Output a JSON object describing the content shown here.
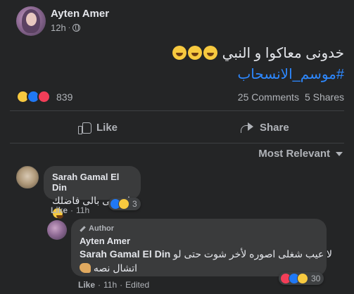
{
  "post": {
    "author": "Ayten Amer",
    "time": "12h",
    "separator": "·",
    "text": "خدونى معاكوا و النبي",
    "hashtag": "#موسم_الانسحاب"
  },
  "reactions": {
    "count": "839",
    "types": [
      "haha-icon",
      "like-icon",
      "love-icon"
    ],
    "comments": "25 Comments",
    "shares": "5 Shares"
  },
  "actions": {
    "like_label": "Like",
    "share_label": "Share"
  },
  "sort": {
    "label": "Most Relevant"
  },
  "comments": [
    {
      "name": "Sarah Gamal El Din",
      "text": "اتبرعى بالى فاضلك",
      "like_label": "Like",
      "time": "11h",
      "reaction_count": "3"
    },
    {
      "author_tag": "Author",
      "name": "Ayten Amer",
      "mention": "Sarah Gamal El Din",
      "text_line1": "لا عيب شغلى اصوره لأخر شوت حتى لو",
      "text_line2": "اتشال نصه",
      "like_label": "Like",
      "time": "11h",
      "edited": "Edited",
      "reaction_count": "30"
    }
  ],
  "colors": {
    "background": "#242526",
    "bubble": "#3a3b3c",
    "text_primary": "#e4e6eb",
    "text_secondary": "#b0b3b8",
    "link": "#2d88ff"
  }
}
